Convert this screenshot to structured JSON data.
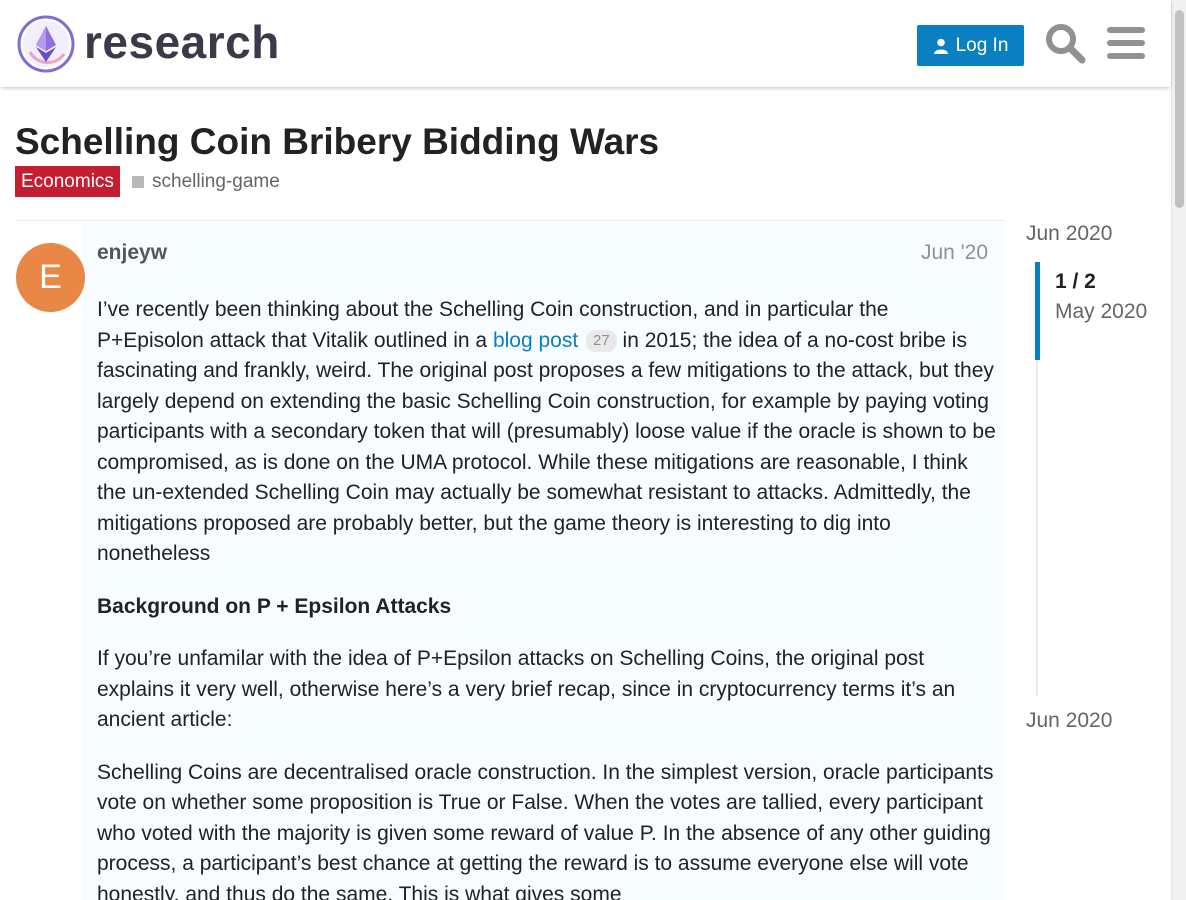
{
  "header": {
    "site_name": "research",
    "login_label": "Log In",
    "icons": [
      "ethereum-logo",
      "user-icon",
      "search-icon",
      "hamburger-menu-icon"
    ]
  },
  "topic": {
    "title": "Schelling Coin Bribery Bidding Wars",
    "category": "Economics",
    "tag": "schelling-game"
  },
  "post": {
    "avatar_letter": "E",
    "username": "enjeyw",
    "date": "Jun '20",
    "p1_a": "I’ve recently been thinking about the Schelling Coin construction, and in particular the P+Episolon attack that Vitalik outlined in a ",
    "p1_link": "blog post",
    "p1_clicks": "27",
    "p1_b": " in 2015; the idea of a no-cost bribe is fascinating and frankly, weird. The original post proposes a few mitigations to the attack, but they largely depend on extending the basic Schelling Coin construction, for example by paying voting participants with a secondary token that will (presumably) loose value if the oracle is shown to be compromised, as is done on the UMA protocol. While these mitigations are reasonable, I think the un-extended Schelling Coin may actually be somewhat resistant to attacks. Admittedly, the mitigations proposed are probably better, but the game theory is interesting to dig into nonetheless",
    "heading": "Background on P + Epsilon Attacks",
    "p2": "If you’re unfamilar with the idea of P+Epsilon attacks on Schelling Coins, the original post explains it very well, otherwise here’s a very brief recap, since in cryptocurrency terms it’s an ancient article:",
    "p3": "Schelling Coins are decentralised oracle construction. In the simplest version, oracle participants vote on whether some proposition is True or False. When the votes are tallied, every participant who voted with the majority is given some reward of value P. In the absence of any other guiding process, a participant’s best chance at getting the reward is to assume everyone else will vote honestly, and thus do the same. This is what gives some"
  },
  "timeline": {
    "start_label": "Jun 2020",
    "position": "1 / 2",
    "position_date": "May 2020",
    "end_label": "Jun 2020"
  },
  "colors": {
    "brand_blue": "#0a7fc2",
    "category_red": "#c51d31",
    "avatar_orange": "#e98746"
  }
}
